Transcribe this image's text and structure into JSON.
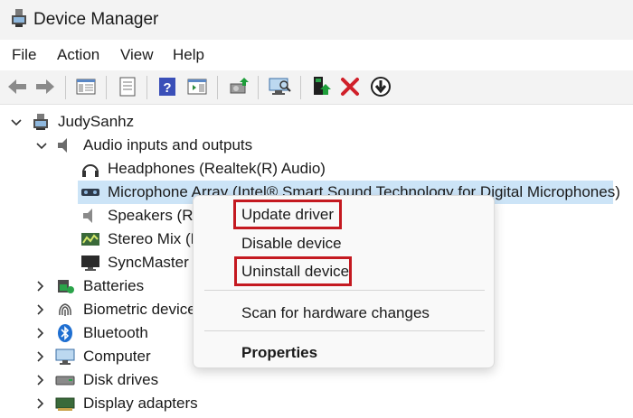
{
  "window": {
    "title": "Device Manager"
  },
  "menubar": {
    "items": [
      "File",
      "Action",
      "View",
      "Help"
    ]
  },
  "toolbar": {
    "buttons": [
      "back-arrow-icon",
      "forward-arrow-icon",
      "show-hide-console-tree-icon",
      "properties-icon",
      "help-icon",
      "action-pane-icon",
      "update-driver-icon",
      "scan-hardware-icon",
      "enable-device-icon",
      "uninstall-icon",
      "disable-device-icon"
    ]
  },
  "tree": {
    "root": "JudySanhz",
    "audio_category": "Audio inputs and outputs",
    "audio_devices": [
      "Headphones (Realtek(R) Audio)",
      "Microphone Array (Intel® Smart Sound Technology for Digital Microphones)",
      "Speakers (Re",
      "Stereo Mix (R",
      "SyncMaster ("
    ],
    "categories": [
      "Batteries",
      "Biometric device",
      "Bluetooth",
      "Computer",
      "Disk drives",
      "Display adapters"
    ]
  },
  "context_menu": {
    "update_driver": "Update driver",
    "disable_device": "Disable device",
    "uninstall_device": "Uninstall device",
    "scan": "Scan for hardware changes",
    "properties": "Properties"
  },
  "colors": {
    "selection": "#cce4f7",
    "highlight_box": "#c41920",
    "uninstall_x": "#d0202a",
    "update_arrow": "#1e9e3a"
  }
}
